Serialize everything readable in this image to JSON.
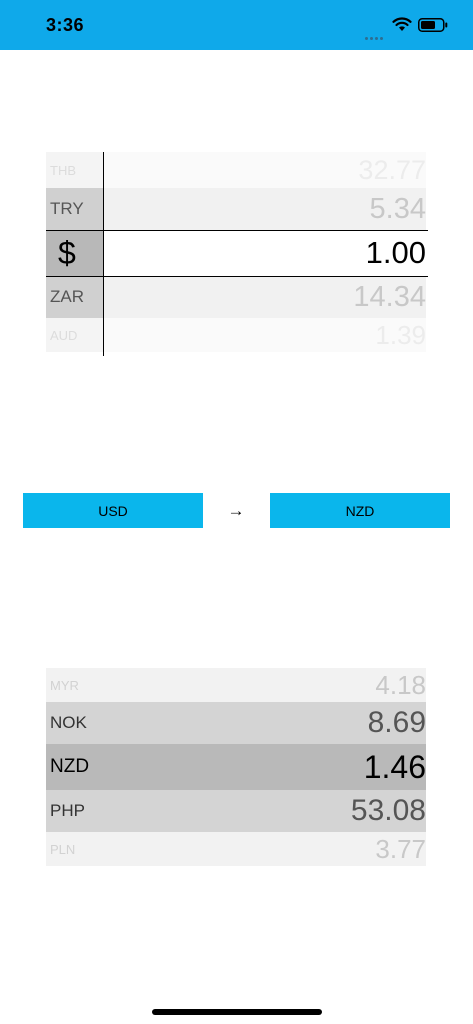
{
  "status_bar": {
    "time": "3:36"
  },
  "source_picker": {
    "rows": [
      {
        "code": "THB",
        "value": "32.77"
      },
      {
        "code": "TRY",
        "value": "5.34"
      },
      {
        "code": "$",
        "value": "1.00"
      },
      {
        "code": "ZAR",
        "value": "14.34"
      },
      {
        "code": "AUD",
        "value": "1.39"
      }
    ]
  },
  "converter": {
    "from_label": "USD",
    "to_label": "NZD",
    "arrow": "→"
  },
  "result_picker": {
    "rows": [
      {
        "code": "MYR",
        "value": "4.18"
      },
      {
        "code": "NOK",
        "value": "8.69"
      },
      {
        "code": "NZD",
        "value": "1.46"
      },
      {
        "code": "PHP",
        "value": "53.08"
      },
      {
        "code": "PLN",
        "value": "3.77"
      }
    ]
  },
  "colors": {
    "status_bar": "#0fa9ea",
    "button": "#0ab6ec"
  }
}
